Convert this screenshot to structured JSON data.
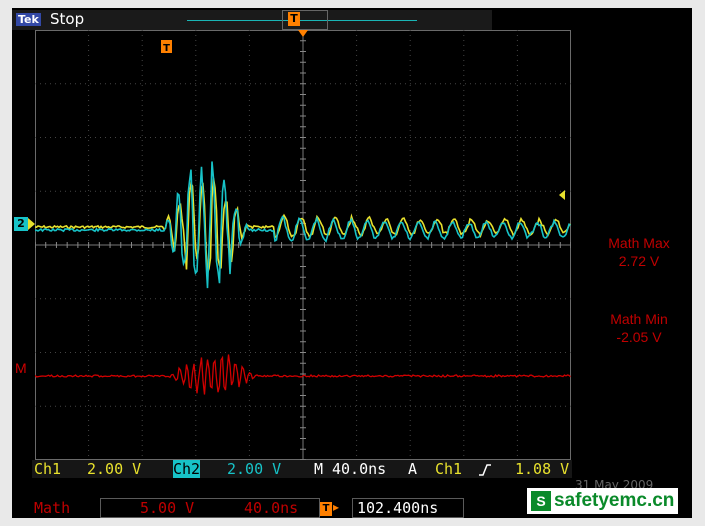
{
  "status": {
    "brand": "Tek",
    "state": "Stop"
  },
  "markers": {
    "trigger": "T",
    "ch2": "2",
    "math": "M"
  },
  "measurements": [
    {
      "label": "Math Max",
      "value": "2.72 V"
    },
    {
      "label": "Math Min",
      "value": "-2.05 V"
    }
  ],
  "bottom": {
    "ch1_label": "Ch1",
    "ch1_scale": "2.00 V",
    "ch2_label": "Ch2",
    "ch2_scale": "2.00 V",
    "m_label": "M",
    "timebase": "40.0ns",
    "a_label": "A",
    "trig_src": "Ch1",
    "trig_level": "1.08 V",
    "math_label": "Math",
    "math_scale": "5.00 V",
    "math_time": "40.0ns",
    "trig_pos": "102.400ns"
  },
  "date": "31 May 2009",
  "watermark": "safetyemc.cn",
  "colors": {
    "ch1": "#e8e12d",
    "ch2": "#17c3c8",
    "math": "#c00000",
    "trigger": "#ff8000"
  },
  "icons": [
    "trigger-marker-icon",
    "rising-edge-icon",
    "logo-s-icon"
  ]
}
